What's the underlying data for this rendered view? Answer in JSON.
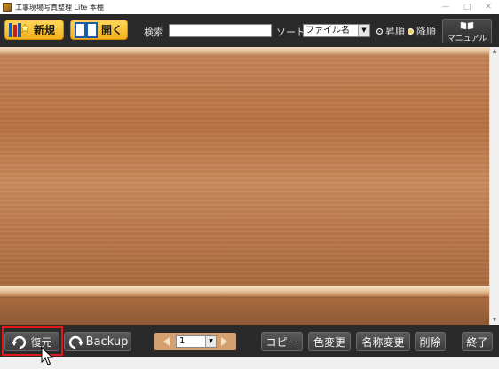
{
  "window": {
    "title": "工事現場写真整理 Lite 本棚",
    "ctrl_min": "—",
    "ctrl_max": "□",
    "ctrl_close": "✕"
  },
  "toolbar": {
    "new_label": "新規",
    "open_label": "開く",
    "search_label": "検索",
    "search_value": "",
    "sort_label": "ソート",
    "sort_value": "ファイル名",
    "asc_label": "昇順",
    "desc_label": "降順",
    "manual_label": "マニュアル",
    "asc_selected": true
  },
  "bottom": {
    "restore_label": "復元",
    "backup_label": "Backup",
    "page_value": "1",
    "copy_label": "コピー",
    "color_label": "色変更",
    "rename_label": "名称変更",
    "delete_label": "削除",
    "exit_label": "終了"
  },
  "colors": {
    "accent_gold": "#f2b11a",
    "bar_dark": "#2a2a2a",
    "highlight": "#e01818"
  }
}
